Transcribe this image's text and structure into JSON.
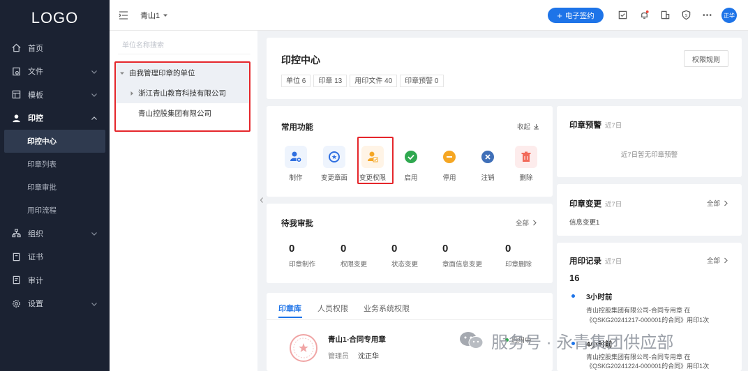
{
  "sidebar": {
    "logo": "LOGO",
    "items": [
      {
        "label": "首页",
        "icon": "home-icon"
      },
      {
        "label": "文件",
        "icon": "file-icon"
      },
      {
        "label": "模板",
        "icon": "template-icon"
      },
      {
        "label": "印控",
        "icon": "user-icon"
      },
      {
        "label": "组织",
        "icon": "org-icon"
      },
      {
        "label": "证书",
        "icon": "certificate-icon"
      },
      {
        "label": "审计",
        "icon": "audit-icon"
      },
      {
        "label": "设置",
        "icon": "gear-icon"
      }
    ],
    "subitems": [
      "印控中心",
      "印章列表",
      "印章审批",
      "用印流程"
    ]
  },
  "header": {
    "org": "青山1",
    "sign_label": "电子签约",
    "avatar": "正华"
  },
  "unit_panel": {
    "search_placeholder": "单位名称搜索",
    "tree": {
      "root": "由我管理印章的单位",
      "child1": "浙江青山教育科技有限公司",
      "child2": "青山控股集团有限公司"
    }
  },
  "center": {
    "title": "印控中心",
    "rules_button": "权限规则",
    "stats": [
      "单位 6",
      "印章 13",
      "用印文件 40",
      "印章预警 0"
    ]
  },
  "common": {
    "title": "常用功能",
    "collapse": "收起",
    "functions": [
      "制作",
      "变更章面",
      "变更权限",
      "启用",
      "停用",
      "注销",
      "删除"
    ]
  },
  "pending": {
    "title": "待我审批",
    "all": "全部",
    "items": [
      {
        "count": "0",
        "label": "印章制作"
      },
      {
        "count": "0",
        "label": "权限变更"
      },
      {
        "count": "0",
        "label": "状态变更"
      },
      {
        "count": "0",
        "label": "章面信息变更"
      },
      {
        "count": "0",
        "label": "印章删除"
      }
    ]
  },
  "tabs": [
    "印章库",
    "人员权限",
    "业务系统权限"
  ],
  "seal": {
    "name": "青山1-合同专用章",
    "status": "启用中",
    "manager_label": "管理员",
    "manager": "沈正华"
  },
  "warning": {
    "title": "印章预警",
    "period": "近7日",
    "empty": "近7日暂无印章预警"
  },
  "change": {
    "title": "印章变更",
    "period": "近7日",
    "all": "全部",
    "item": "信息变更1"
  },
  "usage": {
    "title": "用印记录",
    "period": "近7日",
    "all": "全部",
    "count": "16",
    "records": [
      {
        "time": "3小时前",
        "line1": "青山控股集团有限公司-合同专用章 在",
        "line2": "《QSKG20241217-000001的合同》用印1次"
      },
      {
        "time": "4小时前",
        "line1": "青山控股集团有限公司-合同专用章 在",
        "line2": "《QSKG20241224-000001的合同》用印1次"
      }
    ]
  },
  "watermark": {
    "text": "服务号 · 永青集团供应部"
  }
}
